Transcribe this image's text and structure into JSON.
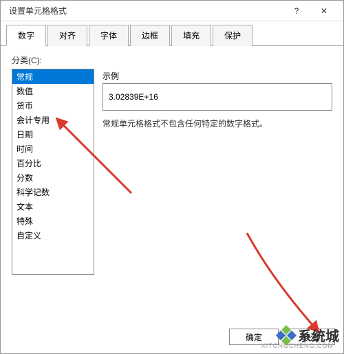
{
  "window": {
    "title": "设置单元格格式",
    "help_glyph": "?",
    "close_glyph": "✕"
  },
  "tabs": [
    {
      "label": "数字",
      "active": true
    },
    {
      "label": "对齐",
      "active": false
    },
    {
      "label": "字体",
      "active": false
    },
    {
      "label": "边框",
      "active": false
    },
    {
      "label": "填充",
      "active": false
    },
    {
      "label": "保护",
      "active": false
    }
  ],
  "category": {
    "label": "分类(C):",
    "items": [
      "常规",
      "数值",
      "货币",
      "会计专用",
      "日期",
      "时间",
      "百分比",
      "分数",
      "科学记数",
      "文本",
      "特殊",
      "自定义"
    ],
    "selected_index": 0
  },
  "sample": {
    "label": "示例",
    "value": "3.02839E+16"
  },
  "description": "常规单元格格式不包含任何特定的数字格式。",
  "buttons": {
    "ok": "确定",
    "cancel": "取消"
  },
  "watermark": {
    "text": "系统城",
    "sub": "XITONGCHENG.COM"
  }
}
